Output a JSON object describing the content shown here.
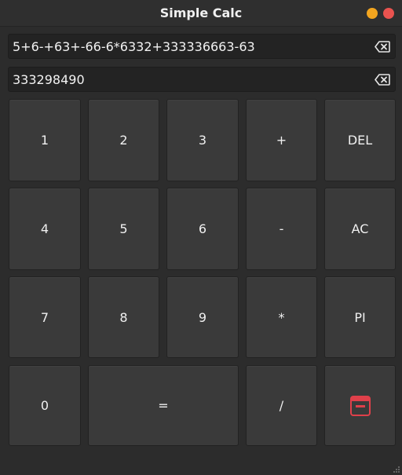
{
  "window": {
    "title": "Simple Calc"
  },
  "expression": {
    "value": "5+6-+63+-66-6*6332+333336663-63"
  },
  "result": {
    "value": "333298490"
  },
  "keys": {
    "one": "1",
    "two": "2",
    "three": "3",
    "plus": "+",
    "del": "DEL",
    "four": "4",
    "five": "5",
    "six": "6",
    "minus": "-",
    "ac": "AC",
    "seven": "7",
    "eight": "8",
    "nine": "9",
    "multiply": "*",
    "pi": "PI",
    "zero": "0",
    "equals": "=",
    "divide": "/"
  },
  "icons": {
    "clear_expression": "backspace-icon",
    "clear_result": "backspace-icon",
    "history": "calendar-icon"
  },
  "colors": {
    "minimize": "#f2a51f",
    "close": "#e9534f",
    "history_icon": "#e0404a"
  }
}
